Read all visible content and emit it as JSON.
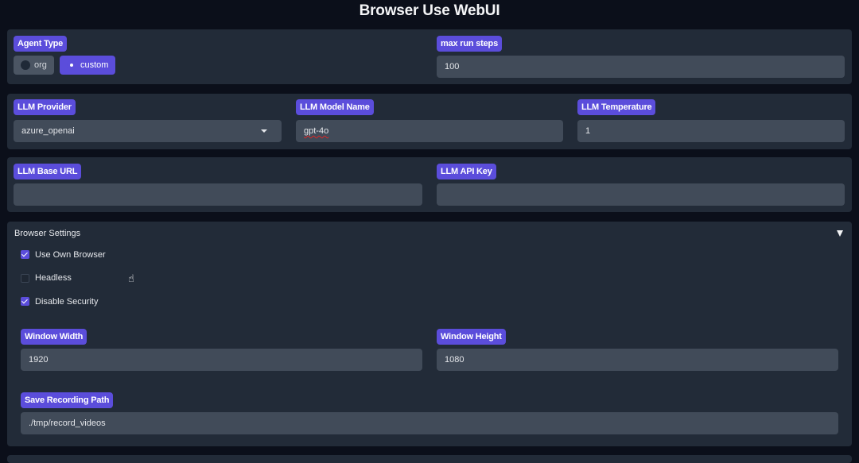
{
  "header": {
    "title": "Browser Use WebUI"
  },
  "agent": {
    "agent_type_label": "Agent Type",
    "options": [
      {
        "label": "org",
        "selected": false
      },
      {
        "label": "custom",
        "selected": true
      }
    ],
    "max_steps_label": "max run steps",
    "max_steps_value": "100"
  },
  "llm": {
    "provider_label": "LLM Provider",
    "provider_value": "azure_openai",
    "model_label": "LLM Model Name",
    "model_value": "gpt-4o",
    "temperature_label": "LLM Temperature",
    "temperature_value": "1",
    "base_url_label": "LLM Base URL",
    "base_url_value": "",
    "api_key_label": "LLM API Key",
    "api_key_value": ""
  },
  "browser": {
    "section_title": "Browser Settings",
    "checkboxes": [
      {
        "label": "Use Own Browser",
        "checked": true
      },
      {
        "label": "Headless",
        "checked": false
      },
      {
        "label": "Disable Security",
        "checked": true
      }
    ],
    "window_width_label": "Window Width",
    "window_width_value": "1920",
    "window_height_label": "Window Height",
    "window_height_value": "1080",
    "recording_path_label": "Save Recording Path",
    "recording_path_value": "./tmp/record_videos"
  },
  "colors": {
    "accent": "#5b4ddb",
    "panel": "#222b38",
    "input": "#414b59",
    "background": "#0b0f1a"
  }
}
